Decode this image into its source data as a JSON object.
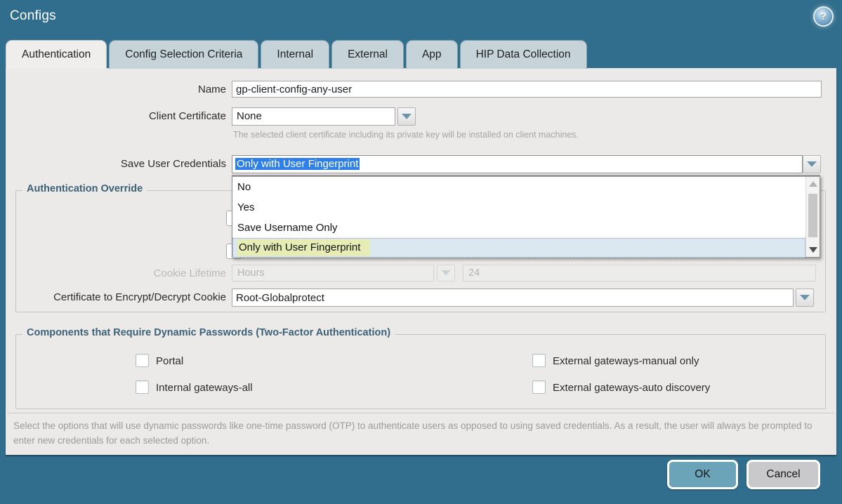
{
  "window": {
    "title": "Configs",
    "help_glyph": "?"
  },
  "tabs": [
    {
      "label": "Authentication",
      "active": true
    },
    {
      "label": "Config Selection Criteria",
      "active": false
    },
    {
      "label": "Internal",
      "active": false
    },
    {
      "label": "External",
      "active": false
    },
    {
      "label": "App",
      "active": false
    },
    {
      "label": "HIP Data Collection",
      "active": false
    }
  ],
  "form": {
    "name": {
      "label": "Name",
      "value": "gp-client-config-any-user"
    },
    "client_certificate": {
      "label": "Client Certificate",
      "value": "None",
      "help": "The selected client certificate including its private key will be installed on client machines."
    },
    "save_user_credentials": {
      "label": "Save User Credentials",
      "value": "Only with User Fingerprint",
      "options": [
        "No",
        "Yes",
        "Save Username Only",
        "Only with User Fingerprint"
      ],
      "selected_option": "Only with User Fingerprint"
    },
    "auth_override": {
      "legend": "Authentication Override",
      "cookie_lifetime": {
        "label": "Cookie Lifetime",
        "unit": "Hours",
        "value": "24",
        "disabled": true
      },
      "cert_cookie": {
        "label": "Certificate to Encrypt/Decrypt Cookie",
        "value": "Root-Globalprotect"
      }
    },
    "components": {
      "legend": "Components that Require Dynamic Passwords (Two-Factor Authentication)",
      "checkboxes": [
        {
          "label": "Portal",
          "checked": false
        },
        {
          "label": "Internal gateways-all",
          "checked": false
        },
        {
          "label": "External gateways-manual only",
          "checked": false
        },
        {
          "label": "External gateways-auto discovery",
          "checked": false
        }
      ]
    },
    "note": "Select the options that will use dynamic passwords like one-time password (OTP) to authenticate users as opposed to using saved credentials. As a result, the user will always be prompted to enter new credentials for each selected option."
  },
  "footer": {
    "ok_label": "OK",
    "cancel_label": "Cancel"
  },
  "colors": {
    "window_teal": "#316e8d",
    "panel_gray": "#ebeae9",
    "selection_blue": "#2e7fe8",
    "option_highlight_yellow": "#e7ebb4",
    "option_row_blue": "#dce8f1",
    "ok_button": "#6ba3b9",
    "cancel_button": "#c9c9cc",
    "legend_text": "#3c6177"
  }
}
